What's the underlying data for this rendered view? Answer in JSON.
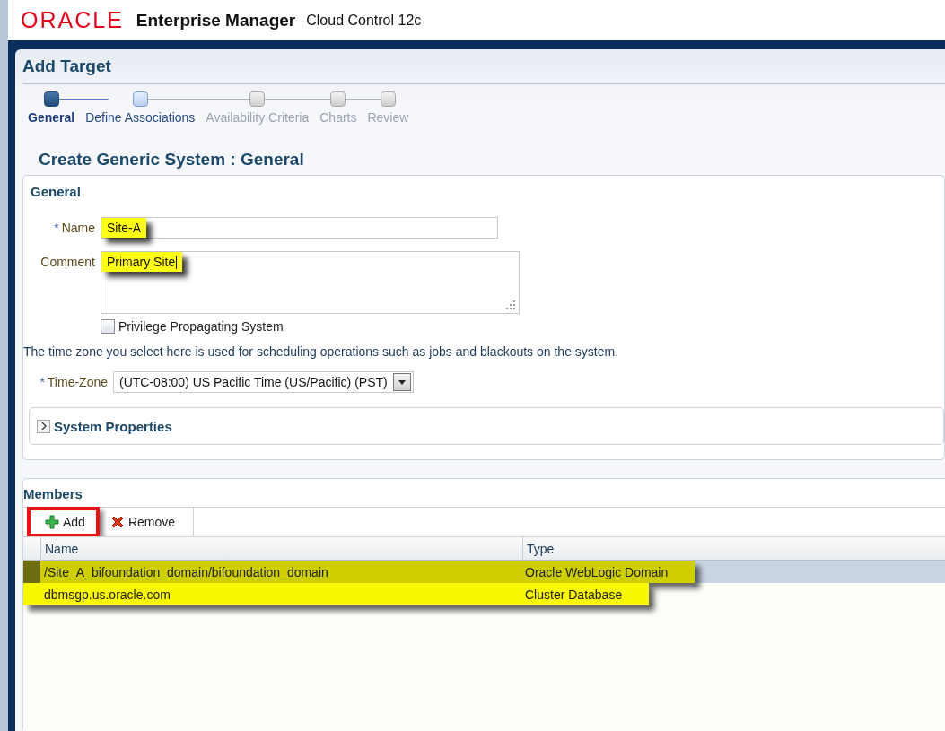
{
  "header": {
    "brand": "ORACLE",
    "product": "Enterprise Manager",
    "edition": "Cloud Control 12c"
  },
  "page_title": "Add Target",
  "train": [
    {
      "label": "General",
      "selected": true,
      "disabled": false
    },
    {
      "label": "Define Associations",
      "selected": false,
      "disabled": false
    },
    {
      "label": "Availability Criteria",
      "selected": false,
      "disabled": true
    },
    {
      "label": "Charts",
      "selected": false,
      "disabled": true
    },
    {
      "label": "Review",
      "selected": false,
      "disabled": true
    }
  ],
  "subtitle": "Create Generic System : General",
  "general": {
    "heading": "General",
    "name": {
      "required_mark": "*",
      "label": "Name",
      "value": "Site-A",
      "highlighted": true
    },
    "comment": {
      "label": "Comment",
      "value": "Primary Site",
      "highlighted": true,
      "focused": true
    },
    "privilege_checkbox": {
      "label": "Privilege Propagating System",
      "checked": false
    },
    "timezone_hint": "The time zone you select here is used for scheduling operations such as jobs and blackouts on the system.",
    "timezone": {
      "required_mark": "*",
      "label": "Time-Zone",
      "value": "(UTC-08:00) US Pacific Time (US/Pacific) (PST)"
    },
    "system_properties": {
      "label": "System Properties",
      "expanded": false
    }
  },
  "members": {
    "heading": "Members",
    "toolbar": [
      {
        "label": "Add",
        "kind": "add",
        "annotated": true
      },
      {
        "label": "Remove",
        "kind": "remove",
        "annotated": false
      }
    ],
    "columns": [
      "Name",
      "Type"
    ],
    "rows": [
      {
        "name": "/Site_A_bifoundation_domain/bifoundation_domain",
        "type": "Oracle WebLogic Domain",
        "selected": true,
        "highlighted": true
      },
      {
        "name": "dbmsgp.us.oracle.com",
        "type": "Cluster Database",
        "selected": false,
        "highlighted": true
      }
    ]
  }
}
